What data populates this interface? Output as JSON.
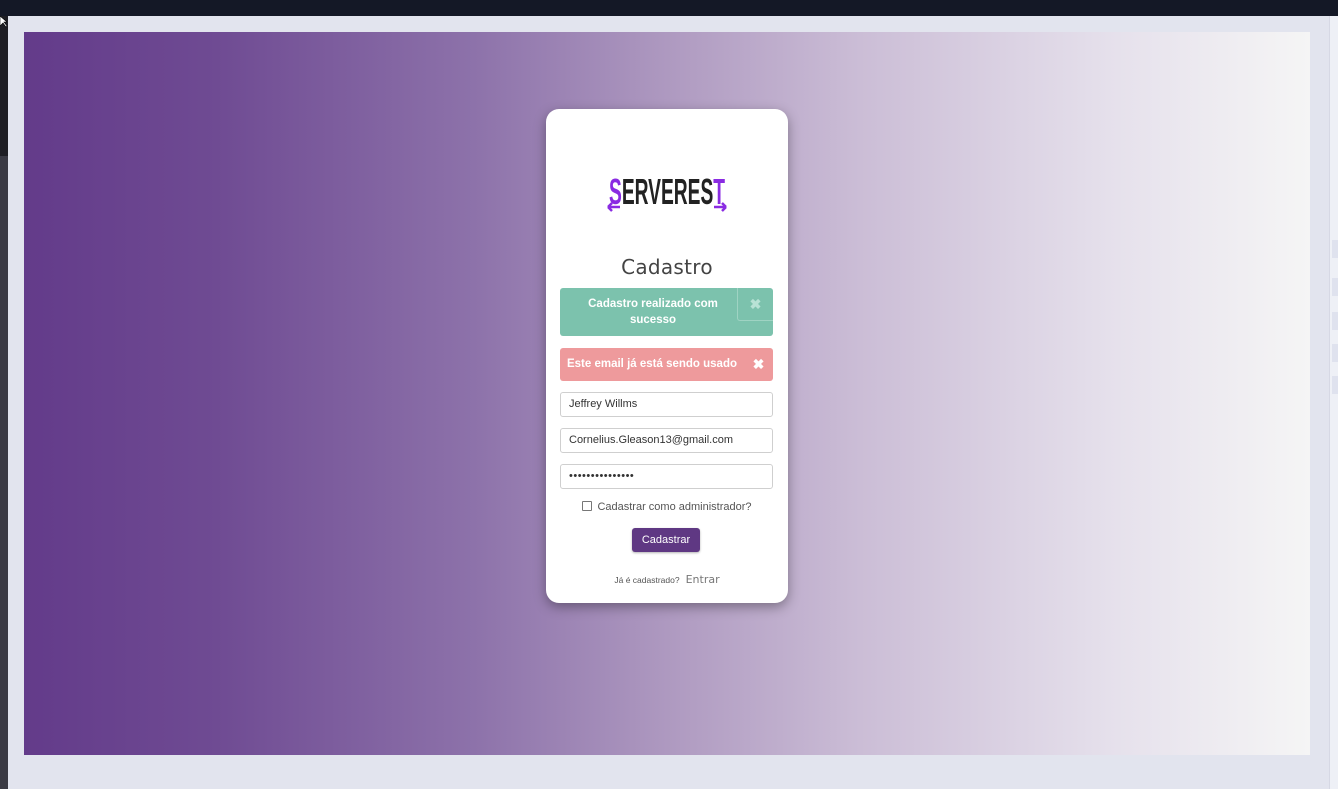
{
  "app": {
    "logo_text": "SERVEREST",
    "title": "Cadastro"
  },
  "alerts": {
    "success": {
      "text": "Cadastro realizado com sucesso",
      "close_symbol": "✖",
      "color": "#7cc2ad"
    },
    "error": {
      "text": "Este email já está sendo usado",
      "close_symbol": "✖",
      "color": "#ee9a9c"
    }
  },
  "form": {
    "name": "Jeffrey Willms",
    "email": "Cornelius.Gleason13@gmail.com",
    "password_mask": "•••••••••••••••",
    "admin_checkbox_label": "Cadastrar como administrador?",
    "admin_checked": false,
    "submit_label": "Cadastrar"
  },
  "footer": {
    "question": "Já é cadastrado?",
    "login_link": "Entrar"
  },
  "colors": {
    "brand": "#5f3883",
    "logo_accent": "#8a2be2",
    "logo_text": "#222222"
  },
  "icons": {
    "close": "close-icon",
    "cursor": "cursor-icon"
  }
}
